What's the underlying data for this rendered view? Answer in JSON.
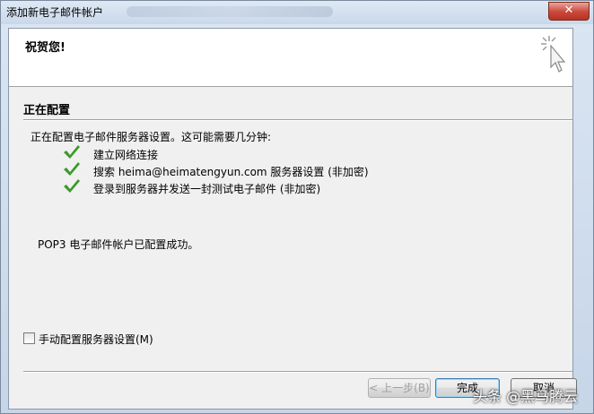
{
  "window": {
    "title": "添加新电子邮件帐户",
    "close_glyph": "✕"
  },
  "header": {
    "congrats": "祝贺您!"
  },
  "config": {
    "section_title": "正在配置",
    "intro": "正在配置电子邮件服务器设置。这可能需要几分钟:",
    "steps": [
      {
        "label": "建立网络连接",
        "status": "done",
        "icon": "checkmark-icon"
      },
      {
        "label": "搜索 heima@heimatengyun.com 服务器设置 (非加密)",
        "status": "done",
        "icon": "checkmark-icon"
      },
      {
        "label": "登录到服务器并发送一封测试电子邮件 (非加密)",
        "status": "done",
        "icon": "checkmark-icon"
      }
    ],
    "result": "POP3 电子邮件帐户已配置成功。"
  },
  "options": {
    "manual_config_label": "手动配置服务器设置(M)",
    "manual_config_checked": false
  },
  "buttons": {
    "back_label": "< 上一步(B)",
    "finish_label": "完成",
    "cancel_label": "取消"
  },
  "watermark": "头条 @黑马腾云",
  "colors": {
    "check_green": "#3a9a2a",
    "close_red": "#c9463a"
  }
}
